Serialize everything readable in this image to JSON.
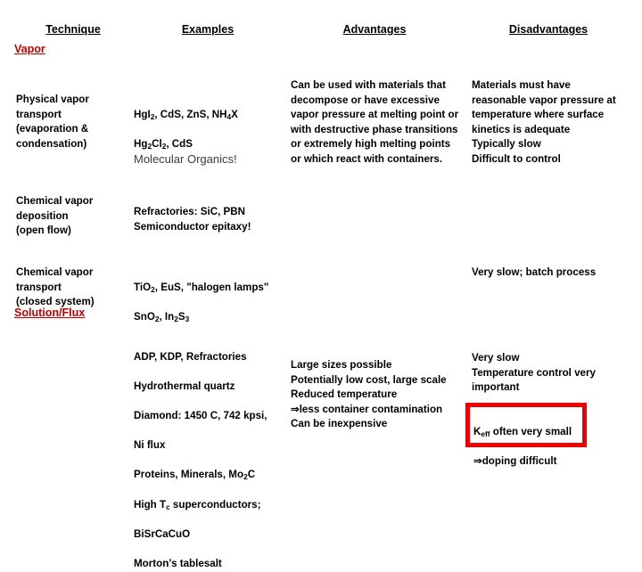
{
  "slide": {
    "columns": [
      {
        "key": "technique",
        "label": "Technique"
      },
      {
        "key": "examples",
        "label": "Examples"
      },
      {
        "key": "advantages",
        "label": "Advantages"
      },
      {
        "key": "disadvantages",
        "label": "Disadvantages"
      }
    ],
    "sections": [
      {
        "key": "vapor",
        "label": "Vapor",
        "color": "#C00000"
      },
      {
        "key": "flux",
        "label": "Solution/Flux",
        "color": "#C00000"
      }
    ],
    "rows": {
      "physical_vapor_transport": {
        "technique": "Physical vapor\ntransport\n(evaporation &\ncondensation)",
        "examples_line1": "HgI2, CdS, ZnS, NH4X",
        "examples_line2": "Hg2Cl2, CdS",
        "examples_line3": "Molecular Organics!",
        "advantages": "Can be used with materials that\ndecompose or have excessive\nvapor pressure at melting point or\nwith destructive phase transitions\nor extremely high melting points\nor which react with containers.",
        "disadvantages": "Materials must have\nreasonable vapor pressure at\ntemperature where surface\nkinetics is adequate\nTypically slow\nDifficult to control"
      },
      "chemical_vapor_deposition": {
        "technique": "Chemical vapor\ndeposition\n(open flow)",
        "examples": "Refractories: SiC, PBN\nSemiconductor epitaxy!",
        "advantages": "",
        "disadvantages": ""
      },
      "chemical_vapor_transport": {
        "technique": "Chemical vapor\ntransport\n(closed system)",
        "examples_line1": "TiO2, EuS, \"halogen lamps\"",
        "examples_line2": "SnO2, In2S3",
        "advantages": "",
        "disadvantages": "Very slow; batch process"
      },
      "solution_flux": {
        "technique": "",
        "examples_line1": "ADP, KDP, Refractories",
        "examples_line2": "Hydrothermal quartz",
        "examples_line3": "Diamond: 1450 C, 742 kpsi,",
        "examples_line4": "Ni flux",
        "examples_line5": "Proteins, Minerals, Mo2C",
        "examples_line6": "High Tc superconductors;",
        "examples_line7": "BiSrCaCuO",
        "examples_line8": "Morton’s tablesalt",
        "advantages": "Large sizes possible\nPotentially low cost, large scale\nReduced temperature\n⇒less container contamination\nCan be inexpensive",
        "disadvantages": "Very slow\nTemperature control very\nimportant"
      }
    },
    "callout": {
      "line1_prefix": "K",
      "line1_sub": "eff",
      "line1_rest": " often very small",
      "line2": "⇒doping difficult",
      "border_color": "#EE0000"
    }
  }
}
